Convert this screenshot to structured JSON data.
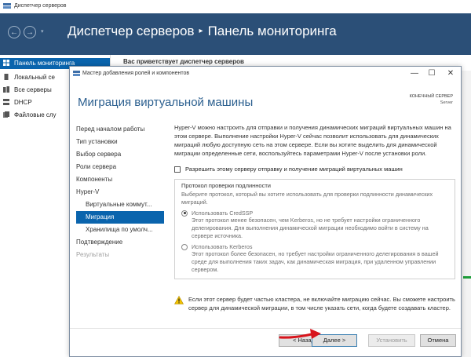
{
  "outer": {
    "window_title": "Диспетчер серверов",
    "breadcrumb_root": "Диспетчер серверов",
    "breadcrumb_sep": "▸",
    "breadcrumb_page": "Панель мониторинга",
    "welcome": "Вас приветствует диспетчер серверов",
    "back_glyph": "←",
    "forward_glyph": "→",
    "dropdown_glyph": "▾"
  },
  "sidebar": {
    "items": [
      {
        "label": "Панель мониторинга",
        "icon": "dashboard-icon"
      },
      {
        "label": "Локальный се",
        "icon": "local-server-icon"
      },
      {
        "label": "Все серверы",
        "icon": "all-servers-icon"
      },
      {
        "label": "DHCP",
        "icon": "dhcp-icon"
      },
      {
        "label": "Файловые слу",
        "icon": "file-services-icon"
      }
    ]
  },
  "dialog": {
    "title": "Мастер добавления ролей и компонентов",
    "min_glyph": "—",
    "max_glyph": "☐",
    "close_glyph": "✕",
    "heading": "Миграция виртуальной машины",
    "server_label": "КОНЕЧНЫЙ СЕРВЕР",
    "server_name": "Server",
    "steps": [
      {
        "label": "Перед началом работы",
        "state": "normal"
      },
      {
        "label": "Тип установки",
        "state": "normal"
      },
      {
        "label": "Выбор сервера",
        "state": "normal"
      },
      {
        "label": "Роли сервера",
        "state": "normal"
      },
      {
        "label": "Компоненты",
        "state": "normal"
      },
      {
        "label": "Hyper-V",
        "state": "normal"
      },
      {
        "label": "Виртуальные коммут...",
        "state": "sub"
      },
      {
        "label": "Миграция",
        "state": "sub-active"
      },
      {
        "label": "Хранилища по умолч...",
        "state": "sub"
      },
      {
        "label": "Подтверждение",
        "state": "normal"
      },
      {
        "label": "Результаты",
        "state": "disabled"
      }
    ],
    "intro": "Hyper-V можно настроить для отправки и получения динамических миграций виртуальных машин на этом сервере. Выполнение настройки Hyper-V сейчас позволит использовать для динамических миграций любую доступную сеть на этом сервере. Если вы хотите выделить для динамической миграции определенные сети, воспользуйтесь параметрами Hyper-V после установки роли.",
    "checkbox_label": "Разрешить этому серверу отправку и получение миграций виртуальных машин",
    "protocol": {
      "legend": "Протокол проверки подлинности",
      "hint": "Выберите протокол, который вы хотите использовать для проверки подлинности динамических миграций.",
      "options": [
        {
          "label": "Использовать CredSSP",
          "desc": "Этот протокол менее безопасен, чем Kerberos, но не требует настройки ограниченного делегирования. Для выполнения динамической миграции необходимо войти в систему на сервере источника.",
          "checked": true
        },
        {
          "label": "Использовать Kerberos",
          "desc": "Этот протокол более безопасен, но требует настройки ограниченного делегирования в вашей среде для выполнения таких задач, как динамическая миграция, при удаленном управлении сервером.",
          "checked": false
        }
      ]
    },
    "warning": "Если этот сервер будет частью кластера, не включайте миграцию сейчас. Вы сможете настроить сервер для динамической миграции, в том числе указать сети, когда будете создавать кластер.",
    "buttons": {
      "prev": "< Назад",
      "next": "Далее >",
      "install": "Установить",
      "cancel": "Отмена"
    }
  },
  "colors": {
    "header_bg": "#2b4f77",
    "accent": "#0a64ad",
    "heading": "#2b5f8f",
    "arrow": "#d8141c"
  }
}
